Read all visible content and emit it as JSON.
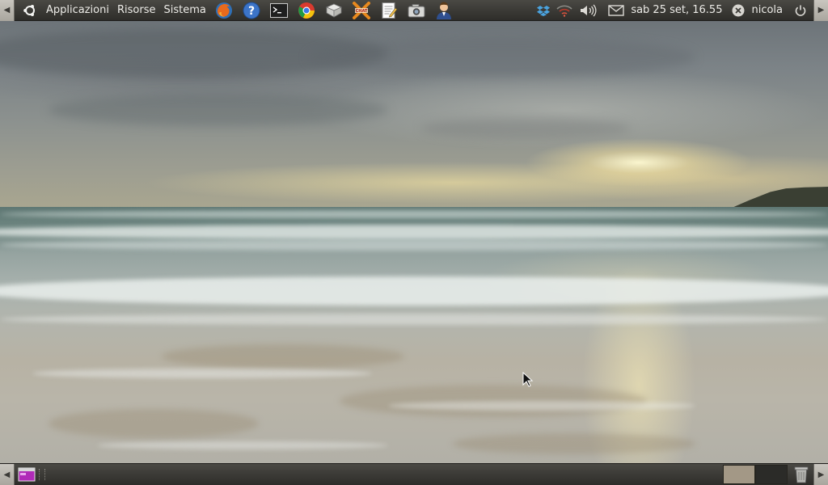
{
  "top_panel": {
    "menus": [
      {
        "label": "Applicazioni"
      },
      {
        "label": "Risorse"
      },
      {
        "label": "Sistema"
      }
    ],
    "launchers": [
      {
        "icon": "firefox-icon"
      },
      {
        "icon": "help-icon"
      },
      {
        "icon": "terminal-icon"
      },
      {
        "icon": "chromium-icon"
      },
      {
        "icon": "document-viewer-icon"
      },
      {
        "icon": "chat-icon"
      },
      {
        "icon": "text-editor-icon"
      },
      {
        "icon": "screenshot-icon"
      },
      {
        "icon": "user-contact-icon"
      }
    ],
    "tray": {
      "icons": [
        "dropbox-icon",
        "wireless-network-icon",
        "volume-icon",
        "mail-icon"
      ],
      "clock": "sab 25 set, 16.55",
      "user_name": "nicola",
      "user_status_icon": "user-offline-icon",
      "power_icon": "power-icon"
    }
  },
  "bottom_panel": {
    "show_desktop_icon": "show-desktop-icon",
    "workspaces": [
      {
        "active": true
      },
      {
        "active": false
      }
    ],
    "trash_icon": "trash-icon"
  },
  "colors": {
    "panel": "#3c3b37",
    "panel_text": "#ecebe7",
    "ubuntu_orange": "#f07746",
    "workspace_active": "#a39886"
  }
}
